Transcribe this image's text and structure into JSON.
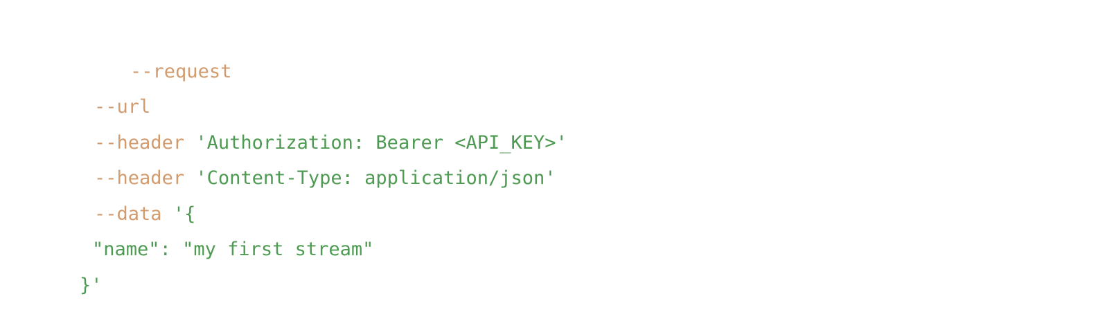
{
  "code_block": {
    "language": "bash",
    "colors": {
      "flag": "#d29b6d",
      "string": "#4e9a52",
      "background": "#ffffff"
    },
    "lines": [
      {
        "flag": "--request",
        "value": ""
      },
      {
        "flag": "--url",
        "value": ""
      },
      {
        "flag": "--header",
        "value": "'Authorization: Bearer <API_KEY>'"
      },
      {
        "flag": "--header",
        "value": "'Content-Type: application/json'"
      },
      {
        "flag": "--data",
        "value": "'{"
      },
      {
        "flag": "",
        "value": "\"name\": \"my first stream\""
      },
      {
        "flag": "",
        "value": "}'"
      }
    ]
  }
}
